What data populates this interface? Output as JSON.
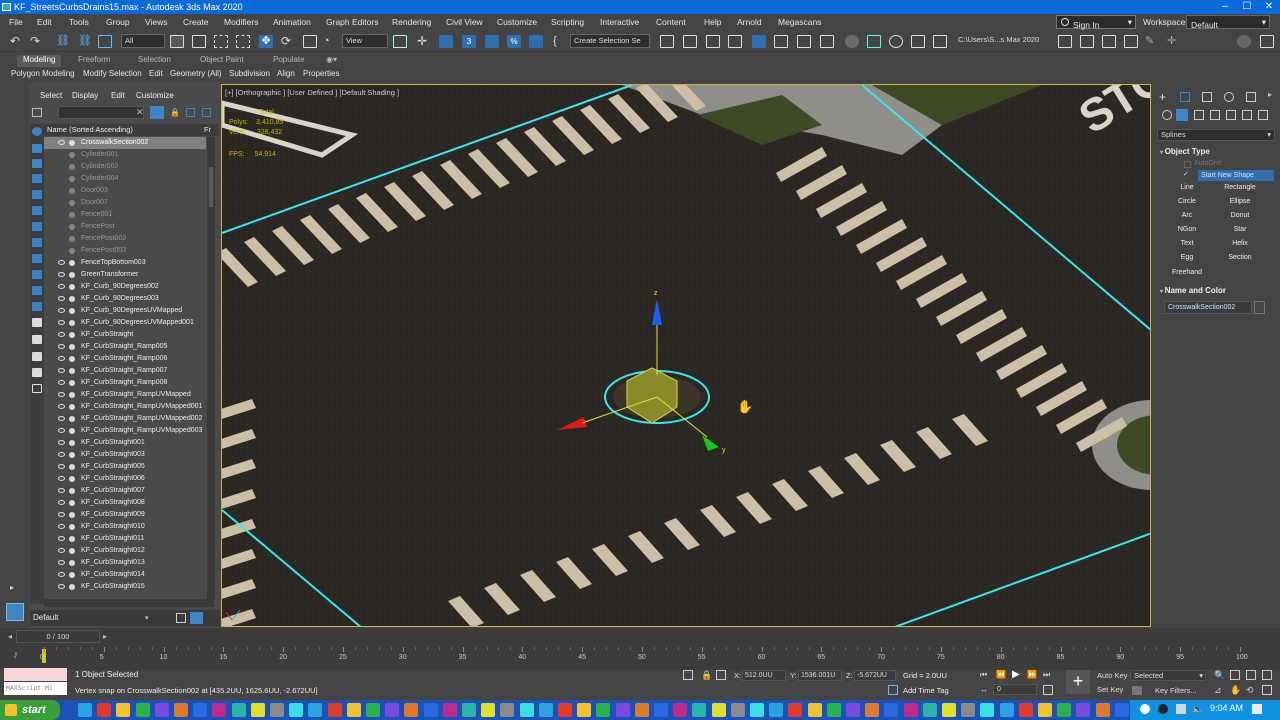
{
  "window": {
    "title": "KF_StreetsCurbsDrains15.max - Autodesk 3ds Max 2020",
    "minimize": "–",
    "maximize": "☐",
    "close": "✕"
  },
  "menu": {
    "items": [
      "File",
      "Edit",
      "Tools",
      "Group",
      "Views",
      "Create",
      "Modifiers",
      "Animation",
      "Graph Editors",
      "Rendering",
      "Civil View",
      "Customize",
      "Scripting",
      "Interactive",
      "Content",
      "Help",
      "Arnold",
      "Megascans"
    ],
    "sign_in": "Sign In",
    "workspaces_label": "Workspaces:",
    "workspace": "Default"
  },
  "toolbar": {
    "selection_filter": "All",
    "view_mode": "View",
    "named_selection": "Create Selection Se",
    "project_path": "C:\\Users\\S...s Max 2020"
  },
  "ribbon": {
    "tabs": [
      "Modeling",
      "Freeform",
      "Selection",
      "Object Paint",
      "Populate"
    ],
    "active_tab": "Modeling",
    "sub_items": [
      "Polygon Modeling",
      "Modify Selection",
      "Edit",
      "Geometry (All)",
      "Subdivision",
      "Align",
      "Properties"
    ]
  },
  "scene_explorer": {
    "tabs": [
      "Select",
      "Display",
      "Edit",
      "Customize"
    ],
    "column_header": "Name (Sorted Ascending)",
    "column_header2": "Fr",
    "items": [
      {
        "name": "CrosswalkSection002",
        "state": "selected"
      },
      {
        "name": "Cylinder001",
        "state": "hidden"
      },
      {
        "name": "Cylinder002",
        "state": "hidden"
      },
      {
        "name": "Cylinder004",
        "state": "hidden"
      },
      {
        "name": "Door003",
        "state": "hidden"
      },
      {
        "name": "Door007",
        "state": "hidden"
      },
      {
        "name": "Fence001",
        "state": "hidden"
      },
      {
        "name": "FencePost",
        "state": "hidden"
      },
      {
        "name": "FencePost002",
        "state": "hidden"
      },
      {
        "name": "FencePost003",
        "state": "hidden"
      },
      {
        "name": "FenceTopBottom003",
        "state": "normal"
      },
      {
        "name": "GreenTransformer",
        "state": "normal"
      },
      {
        "name": "KF_Curb_90Degrees002",
        "state": "normal"
      },
      {
        "name": "KF_Curb_90Degrees003",
        "state": "normal"
      },
      {
        "name": "KF_Curb_90DegreesUVMapped",
        "state": "normal"
      },
      {
        "name": "KF_Curb_90DegreesUVMapped001",
        "state": "normal"
      },
      {
        "name": "KF_CurbStraight",
        "state": "normal"
      },
      {
        "name": "KF_CurbStraight_Ramp005",
        "state": "normal"
      },
      {
        "name": "KF_CurbStraight_Ramp006",
        "state": "normal"
      },
      {
        "name": "KF_CurbStraight_Ramp007",
        "state": "normal"
      },
      {
        "name": "KF_CurbStraight_Ramp008",
        "state": "normal"
      },
      {
        "name": "KF_CurbStraight_RampUVMapped",
        "state": "normal"
      },
      {
        "name": "KF_CurbStraight_RampUVMapped001",
        "state": "normal"
      },
      {
        "name": "KF_CurbStraight_RampUVMapped002",
        "state": "normal"
      },
      {
        "name": "KF_CurbStraight_RampUVMapped003",
        "state": "normal"
      },
      {
        "name": "KF_CurbStraight001",
        "state": "normal"
      },
      {
        "name": "KF_CurbStraight003",
        "state": "normal"
      },
      {
        "name": "KF_CurbStraight005",
        "state": "normal"
      },
      {
        "name": "KF_CurbStraight006",
        "state": "normal"
      },
      {
        "name": "KF_CurbStraight007",
        "state": "normal"
      },
      {
        "name": "KF_CurbStraight008",
        "state": "normal"
      },
      {
        "name": "KF_CurbStraight009",
        "state": "normal"
      },
      {
        "name": "KF_CurbStraight010",
        "state": "normal"
      },
      {
        "name": "KF_CurbStraight011",
        "state": "normal"
      },
      {
        "name": "KF_CurbStraight012",
        "state": "normal"
      },
      {
        "name": "KF_CurbStraight013",
        "state": "normal"
      },
      {
        "name": "KF_CurbStraight014",
        "state": "normal"
      },
      {
        "name": "KF_CurbStraight015",
        "state": "normal"
      }
    ],
    "layer": "Default"
  },
  "viewport": {
    "label": "[+] [Orthographic ] [User Defined ] [Default Shading ]",
    "stats": {
      "total_label": "Total",
      "polys_label": "Polys:",
      "polys": "3,410,85",
      "verts_label": "Verts:",
      "verts": "328,432",
      "fps_label": "FPS:",
      "fps": "54.914"
    },
    "gizmo_axis_z": "z",
    "gizmo_axis_y": "y",
    "road_text": "STOP"
  },
  "command_panel": {
    "category": "Splines",
    "object_type_title": "Object Type",
    "autogrid": "AutoGrid",
    "start_new_shape": "Start New Shape",
    "buttons": [
      "Line",
      "Rectangle",
      "Circle",
      "Ellipse",
      "Arc",
      "Donut",
      "NGon",
      "Star",
      "Text",
      "Helix",
      "Egg",
      "Section",
      "Freehand"
    ],
    "name_color_title": "Name and Color",
    "object_name": "CrosswalkSection002"
  },
  "timeline": {
    "frame": "0 / 100",
    "ticks": [
      "0",
      "5",
      "10",
      "15",
      "20",
      "25",
      "30",
      "35",
      "40",
      "45",
      "50",
      "55",
      "60",
      "65",
      "70",
      "75",
      "80",
      "85",
      "90",
      "95",
      "100"
    ]
  },
  "status": {
    "selection": "1 Object Selected",
    "prompt": "Vertex snap on CrosswalkSection002 at [435.2UU, 1625.6UU, -2.672UU]",
    "maxscript": "MAXScript Mi",
    "x_label": "X:",
    "x": "512.0UU",
    "y_label": "Y:",
    "y": "1536.001U",
    "z_label": "Z:",
    "z": "-5.672UU",
    "grid": "Grid = 2.0UU",
    "add_time_tag": "Add Time Tag",
    "auto_key": "Auto Key",
    "set_key": "Set Key",
    "key_mode": "Selected",
    "key_filters": "Key Filters...",
    "frame_field": "0"
  },
  "taskbar": {
    "start": "start",
    "clock": "9:04 AM"
  }
}
